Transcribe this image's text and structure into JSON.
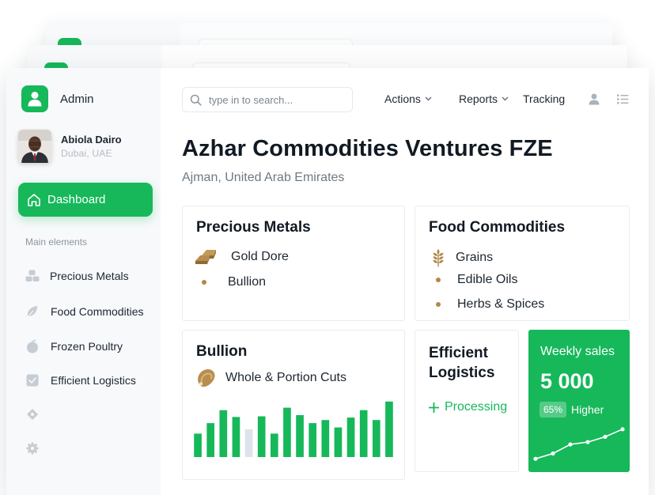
{
  "app": {
    "name": "Admin"
  },
  "user": {
    "name": "Abiola Dairo",
    "location": "Dubai, UAE"
  },
  "sidebar": {
    "active": {
      "label": "Dashboard",
      "icon": "home-icon"
    },
    "section_label": "Main elements",
    "items": [
      {
        "label": "Precious Metals",
        "icon": "cubes-icon"
      },
      {
        "label": "Food Commodities",
        "icon": "leaf-icon"
      },
      {
        "label": "Frozen Poultry",
        "icon": "apple-icon"
      },
      {
        "label": "Efficient Logistics",
        "icon": "checkbox-icon"
      },
      {
        "label": "",
        "icon": "diamond-icon"
      },
      {
        "label": "",
        "icon": "gear-icon"
      }
    ]
  },
  "header": {
    "search_placeholder": "type in to search...",
    "menus": [
      {
        "label": "Actions"
      },
      {
        "label": "Reports"
      },
      {
        "label": "Tracking"
      }
    ]
  },
  "page": {
    "title": "Azhar Commodities Ventures FZE",
    "subtitle": "Ajman, United Arab Emirates"
  },
  "cards": {
    "precious_metals": {
      "title": "Precious Metals",
      "items": [
        {
          "label": "Gold Dore",
          "icon": "gold-bars-icon"
        },
        {
          "label": "Bullion",
          "icon": "dot"
        }
      ]
    },
    "food_commodities": {
      "title": "Food Commodities",
      "items": [
        {
          "label": "Grains",
          "icon": "wheat-icon"
        },
        {
          "label": "Edible Oils",
          "icon": "dot"
        },
        {
          "label": "Herbs & Spices",
          "icon": "dot"
        }
      ]
    },
    "bullion": {
      "title": "Bullion",
      "item": {
        "label": "Whole & Portion Cuts",
        "icon": "meat-icon"
      }
    },
    "logistics": {
      "title": "Efficient Logistics",
      "status": "Processing"
    },
    "weekly_sales": {
      "title": "Weekly sales",
      "value": "5 000",
      "badge": "65%",
      "trend": "Higher"
    }
  },
  "colors": {
    "accent": "#16b85a",
    "gold": "#b0884a",
    "muted_bar": "#dde3ea"
  },
  "chart_data": [
    {
      "type": "bar",
      "values": [
        38,
        55,
        76,
        65,
        45,
        66,
        38,
        80,
        68,
        55,
        60,
        48,
        64,
        76,
        60,
        90
      ],
      "muted_index": 4,
      "ylim": [
        0,
        100
      ]
    },
    {
      "type": "line",
      "values": [
        5,
        12,
        24,
        27,
        34,
        44
      ],
      "ylim": [
        0,
        50
      ]
    }
  ]
}
